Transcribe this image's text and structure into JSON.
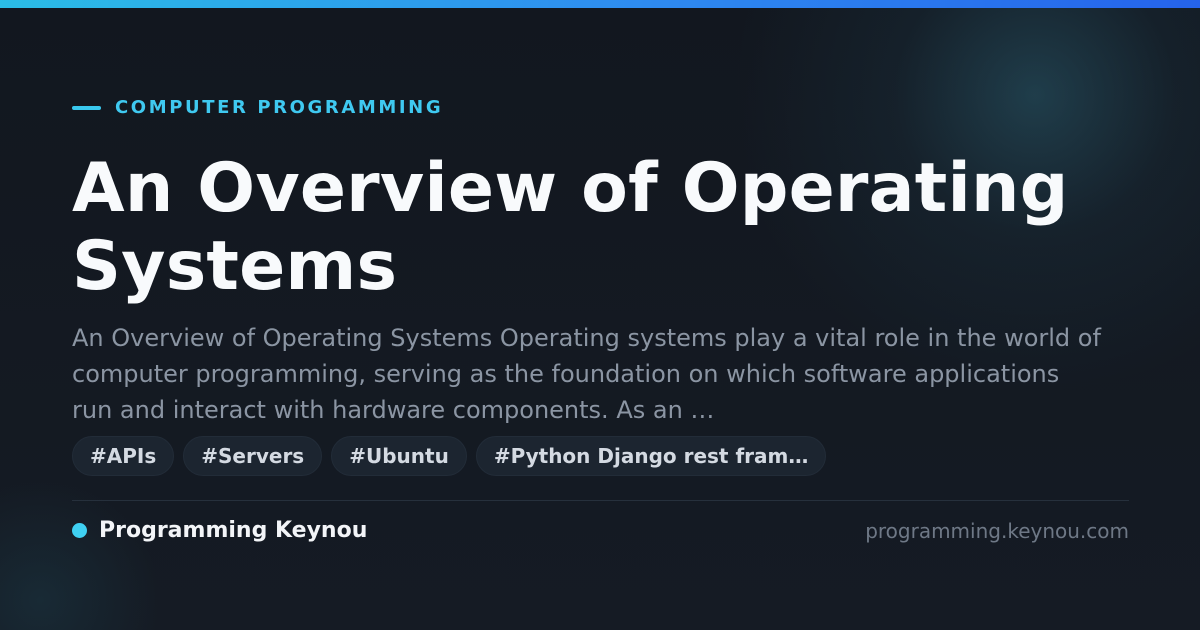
{
  "category": "COMPUTER PROGRAMMING",
  "title": "An Overview of Operating Systems",
  "description": "An Overview of Operating Systems Operating systems play a vital role in the world of computer programming, serving as the foundation on which software applications run and interact with hardware components. As an …",
  "tags": [
    "#APIs",
    "#Servers",
    "#Ubuntu",
    "#Python Django rest fram…"
  ],
  "footer": {
    "brand": "Programming Keynou",
    "url": "programming.keynou.com"
  },
  "colors": {
    "accent": "#3fc9f0",
    "background": "#131820",
    "top_bar_start": "#2bbde6",
    "top_bar_end": "#2563eb"
  }
}
